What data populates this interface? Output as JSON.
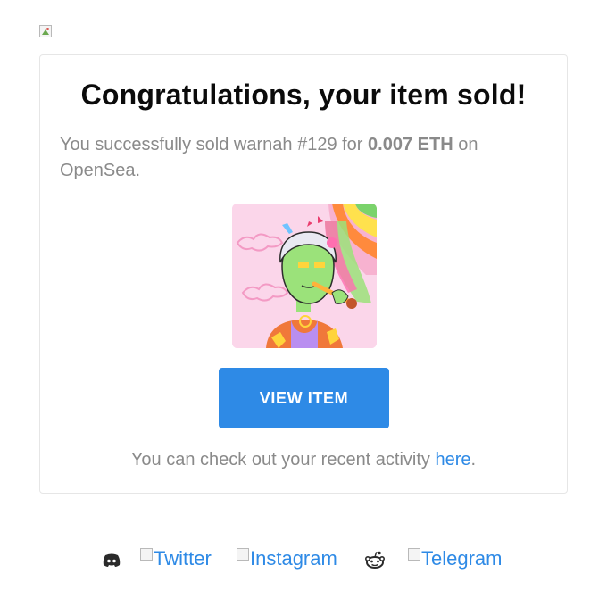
{
  "header": {
    "logo_alt": ""
  },
  "card": {
    "title": "Congratulations, your item sold!",
    "message_prefix": "You successfully sold warnah #129 for ",
    "price": "0.007 ETH",
    "message_suffix": " on OpenSea.",
    "item_image": {
      "subject": "warnah #129 character artwork"
    },
    "button_label": "VIEW ITEM",
    "activity_prefix": "You can check out your recent activity ",
    "activity_link": "here",
    "activity_suffix": "."
  },
  "footer": {
    "links": [
      {
        "icon": "discord-icon"
      },
      {
        "label": "Twitter"
      },
      {
        "label": "Instagram"
      },
      {
        "icon": "reddit-icon"
      },
      {
        "label": "Telegram"
      }
    ]
  },
  "colors": {
    "accent": "#2e8ae6",
    "text_muted": "#8a8a8a",
    "title": "#0b0b0b",
    "card_border": "#e6e6e6"
  }
}
